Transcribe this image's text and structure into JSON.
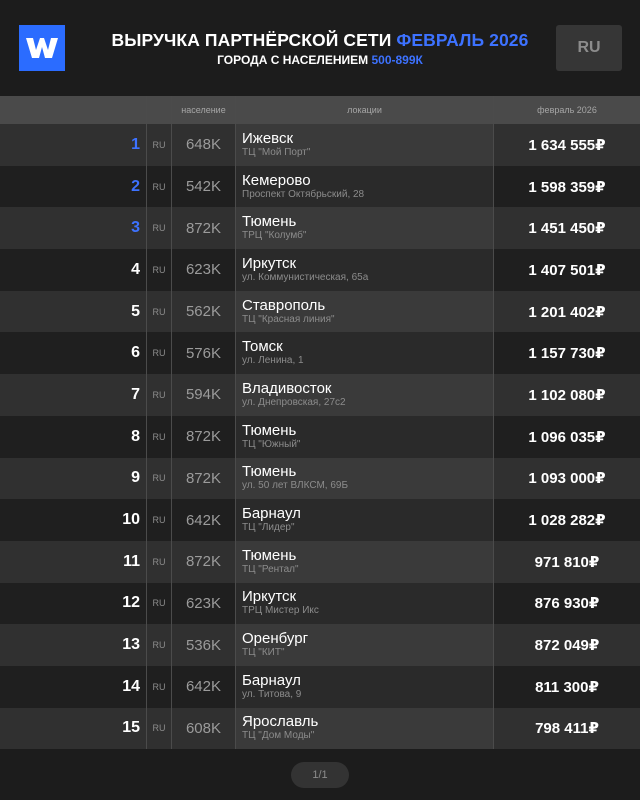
{
  "header": {
    "logo_text": "W",
    "title_main": "ВЫРУЧКА ПАРТНЁРСКОЙ СЕТИ",
    "title_accent": "ФЕВРАЛЬ 2026",
    "subtitle_main": "ГОРОДА С НАСЕЛЕНИЕМ",
    "subtitle_accent": "500-899К",
    "country_button": "RU",
    "accent_color": "#3d72ff",
    "logo_color": "#2b6cff"
  },
  "table": {
    "columns": {
      "population": "население",
      "locations": "локации",
      "revenue": "февраль 2026"
    },
    "rows": [
      {
        "rank": "1",
        "country": "RU",
        "population": "648K",
        "city": "Ижевск",
        "place": "ТЦ \"Мой Порт\"",
        "revenue": "1 634 555₽"
      },
      {
        "rank": "2",
        "country": "RU",
        "population": "542K",
        "city": "Кемерово",
        "place": "Проспект Октябрьский, 28",
        "revenue": "1 598 359₽"
      },
      {
        "rank": "3",
        "country": "RU",
        "population": "872K",
        "city": "Тюмень",
        "place": "ТРЦ \"Колумб\"",
        "revenue": "1 451 450₽"
      },
      {
        "rank": "4",
        "country": "RU",
        "population": "623K",
        "city": "Иркутск",
        "place": "ул. Коммунистическая, 65а",
        "revenue": "1 407 501₽"
      },
      {
        "rank": "5",
        "country": "RU",
        "population": "562K",
        "city": "Ставрополь",
        "place": "ТЦ \"Красная линия\"",
        "revenue": "1 201 402₽"
      },
      {
        "rank": "6",
        "country": "RU",
        "population": "576K",
        "city": "Томск",
        "place": "ул. Ленина, 1",
        "revenue": "1 157 730₽"
      },
      {
        "rank": "7",
        "country": "RU",
        "population": "594K",
        "city": "Владивосток",
        "place": "ул. Днепровская, 27с2",
        "revenue": "1 102 080₽"
      },
      {
        "rank": "8",
        "country": "RU",
        "population": "872K",
        "city": "Тюмень",
        "place": "ТЦ \"Южный\"",
        "revenue": "1 096 035₽"
      },
      {
        "rank": "9",
        "country": "RU",
        "population": "872K",
        "city": "Тюмень",
        "place": "ул. 50 лет ВЛКСМ, 69Б",
        "revenue": "1 093 000₽"
      },
      {
        "rank": "10",
        "country": "RU",
        "population": "642K",
        "city": "Барнаул",
        "place": "ТЦ \"Лидер\"",
        "revenue": "1 028 282₽"
      },
      {
        "rank": "11",
        "country": "RU",
        "population": "872K",
        "city": "Тюмень",
        "place": "ТЦ \"Рентал\"",
        "revenue": "971 810₽"
      },
      {
        "rank": "12",
        "country": "RU",
        "population": "623K",
        "city": "Иркутск",
        "place": "ТРЦ Мистер Икс",
        "revenue": "876 930₽"
      },
      {
        "rank": "13",
        "country": "RU",
        "population": "536K",
        "city": "Оренбург",
        "place": "ТЦ \"КИТ\"",
        "revenue": "872 049₽"
      },
      {
        "rank": "14",
        "country": "RU",
        "population": "642K",
        "city": "Барнаул",
        "place": "ул. Титова, 9",
        "revenue": "811 300₽"
      },
      {
        "rank": "15",
        "country": "RU",
        "population": "608K",
        "city": "Ярославль",
        "place": "ТЦ \"Дом Моды\"",
        "revenue": "798 411₽"
      }
    ]
  },
  "pager": {
    "label": "1/1"
  }
}
